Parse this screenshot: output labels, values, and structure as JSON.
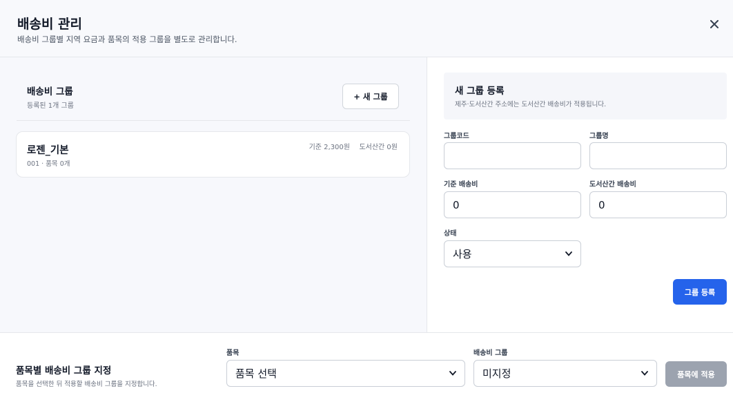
{
  "header": {
    "title": "배송비 관리",
    "subtitle": "배송비 그룹별 지역 요금과 품목의 적용 그룹을 별도로 관리합니다."
  },
  "groups_panel": {
    "title": "배송비 그룹",
    "count_text": "등록된 1개 그룹",
    "new_group_label": "+ 새 그룹",
    "groups": [
      {
        "name": "로젠_기본",
        "meta": "001 · 품목 0개",
        "base_fee": "기준 2,300원",
        "island_fee": "도서산간 0원"
      }
    ]
  },
  "form": {
    "title": "새 그룹 등록",
    "description": "제주·도서산간 주소에는 도서산간 배송비가 적용됩니다.",
    "code_label": "그룹코드",
    "code_value": "",
    "name_label": "그룹명",
    "name_value": "",
    "base_fee_label": "기준 배송비",
    "base_fee_value": "0",
    "island_fee_label": "도서산간 배송비",
    "island_fee_value": "0",
    "status_label": "상태",
    "status_value": "사용",
    "register_label": "그룹 등록"
  },
  "assign": {
    "title": "품목별 배송비 그룹 지정",
    "description": "품목을 선택한 뒤 적용할 배송비 그룹을 지정합니다.",
    "item_label": "품목",
    "item_value": "품목 선택",
    "group_label": "배송비 그룹",
    "group_value": "미지정",
    "apply_label": "품목에 적용"
  },
  "colors": {
    "primary": "#2563eb",
    "disabled": "#9ca3af",
    "panel_bg": "#f7f8fc"
  }
}
